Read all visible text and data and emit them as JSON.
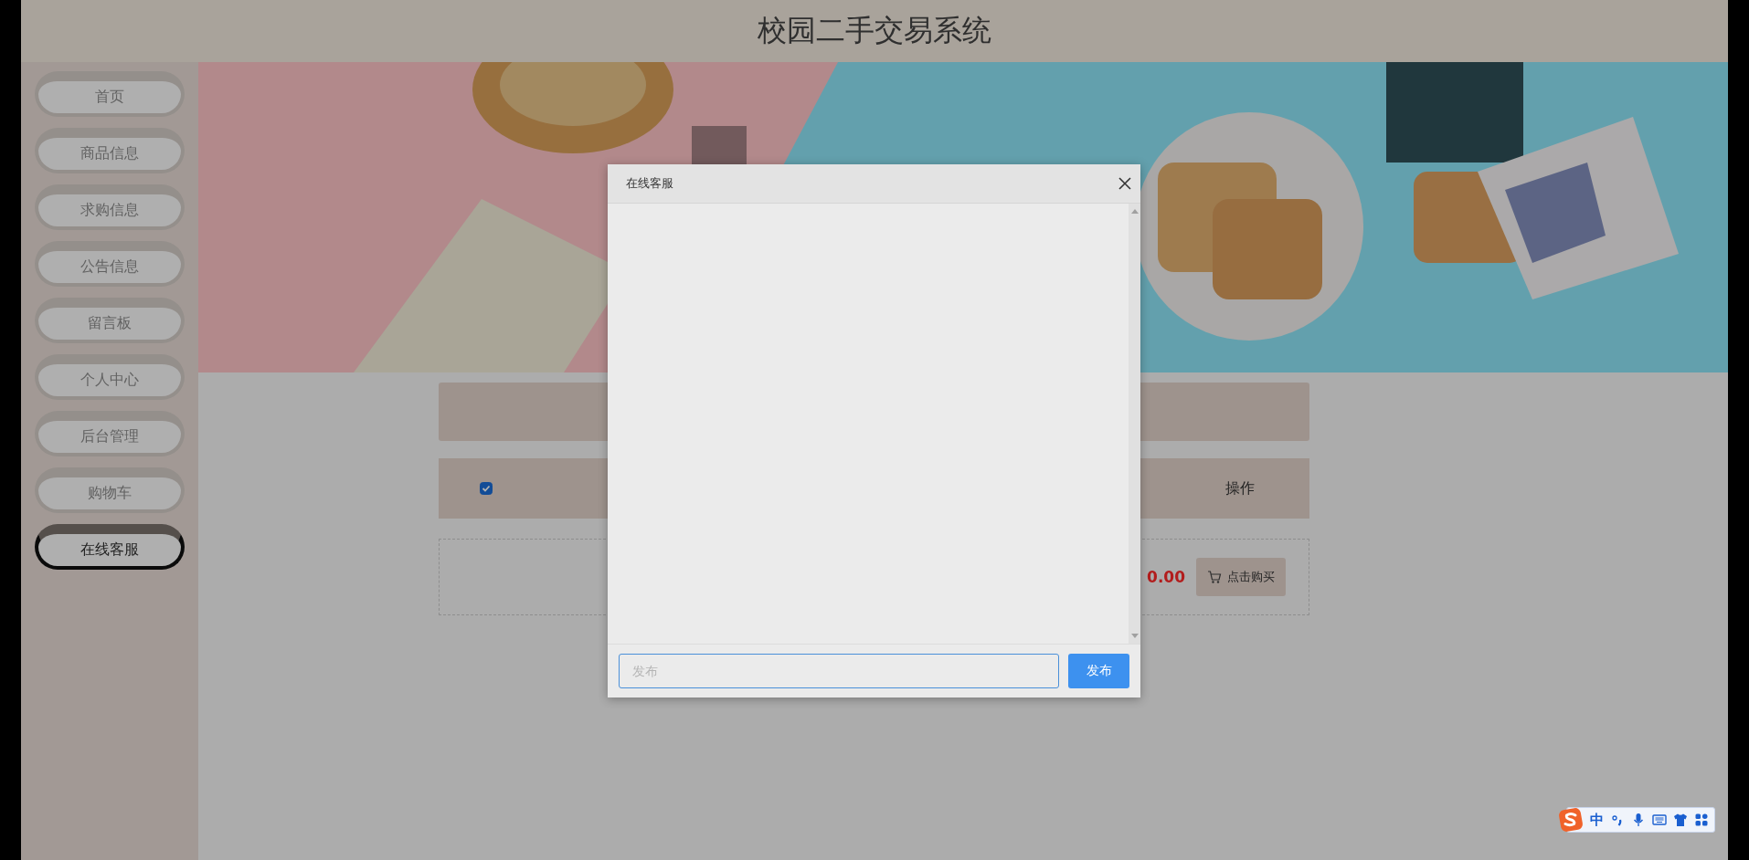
{
  "header": {
    "title": "校园二手交易系统"
  },
  "sidebar": {
    "items": [
      {
        "label": "首页",
        "selected": false
      },
      {
        "label": "商品信息",
        "selected": false
      },
      {
        "label": "求购信息",
        "selected": false
      },
      {
        "label": "公告信息",
        "selected": false
      },
      {
        "label": "留言板",
        "selected": false
      },
      {
        "label": "个人中心",
        "selected": false
      },
      {
        "label": "后台管理",
        "selected": false
      },
      {
        "label": "购物车",
        "selected": false
      },
      {
        "label": "在线客服",
        "selected": true
      }
    ]
  },
  "cart": {
    "header": {
      "checked": true,
      "action_label": "操作"
    },
    "rows": [
      {
        "price": "0.00",
        "buy_button": "点击购买"
      }
    ]
  },
  "dialog": {
    "title": "在线客服",
    "input": {
      "placeholder": "发布"
    },
    "send_button": "发布"
  },
  "ime_toolbar": {
    "mode": "中"
  }
}
